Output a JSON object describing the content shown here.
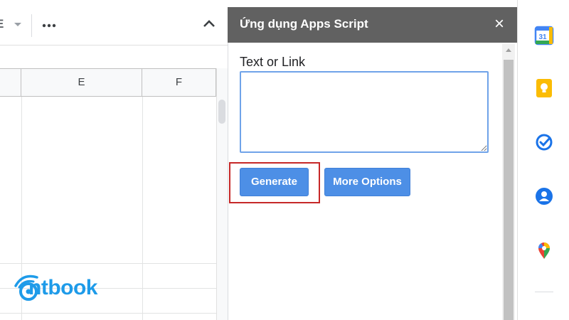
{
  "toolbar": {
    "partial_glyph": "E",
    "more_icon": "more-horizontal-icon",
    "collapse_icon": "chevron-up-icon"
  },
  "grid": {
    "columns": [
      "E",
      "F"
    ]
  },
  "logo": {
    "text": "ntbook",
    "color": "#1e9be9"
  },
  "panel": {
    "title": "Ứng dụng Apps Script",
    "close_glyph": "×",
    "field_label": "Text or Link",
    "field_value": "",
    "generate_label": "Generate",
    "more_options_label": "More Options",
    "button_color": "#4d8fe6",
    "highlight_color": "#c62828"
  },
  "side_panel": {
    "icons": [
      "calendar-icon",
      "keep-icon",
      "tasks-icon",
      "contacts-icon",
      "maps-icon"
    ],
    "calendar_day": "31"
  }
}
